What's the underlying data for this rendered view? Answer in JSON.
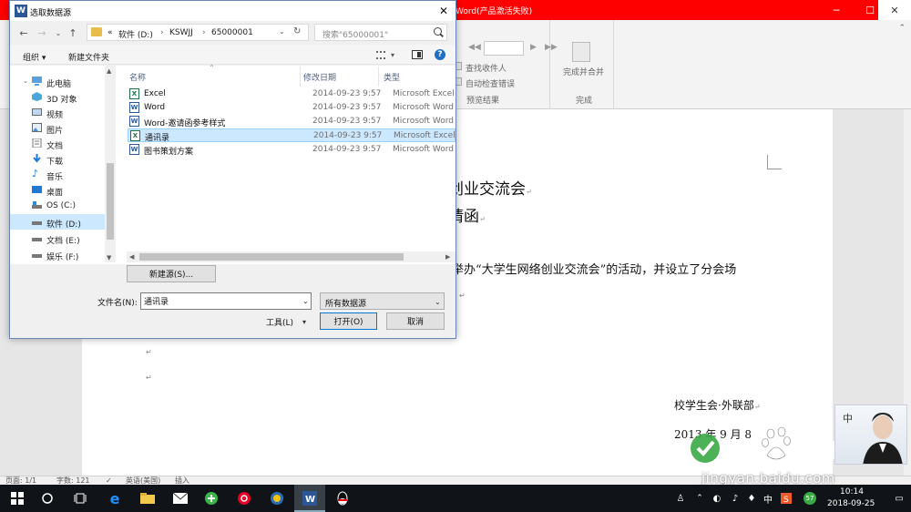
{
  "word": {
    "title_suffix": "Word(产品激活失败)",
    "ribbon": {
      "find_recipient": "查找收件人",
      "auto_check": "自动检查错误",
      "preview_group": "预览结果",
      "finish_merge": "完成并合并",
      "finish_group": "完成"
    },
    "document": {
      "title_line1": "创业交流会",
      "title_line2": "请函",
      "body_line": "举办“大学生网络创业交流会”的活动，并设立了分会场",
      "sign_line1": "校学生会·外联部",
      "sign_line2": "2013 年 9 月 8",
      "para_mark": "↵"
    },
    "status": {
      "page": "页面: 1/1",
      "words": "字数: 121",
      "language": "英语(美国)",
      "insert": "插入"
    }
  },
  "watermark": {
    "url": "jingyan.baidu.com"
  },
  "taskbar": {
    "time": "10:14",
    "date": "2018-09-25",
    "ime": "中",
    "badge": "57"
  },
  "dialog": {
    "title": "选取数据源",
    "title_icon": "W",
    "address": {
      "prefix": "«",
      "segments": [
        "软件 (D:)",
        "KSWJJ",
        "65000001"
      ],
      "separator": "›"
    },
    "search_placeholder": "搜索\"65000001\"",
    "commands": {
      "organize": "组织 ▾",
      "new_folder": "新建文件夹"
    },
    "nav_items": [
      {
        "label": "此电脑",
        "icon": "computer-icon"
      },
      {
        "label": "3D 对象",
        "icon": "cube-icon"
      },
      {
        "label": "视频",
        "icon": "video-icon"
      },
      {
        "label": "图片",
        "icon": "picture-icon"
      },
      {
        "label": "文档",
        "icon": "document-icon"
      },
      {
        "label": "下载",
        "icon": "download-icon"
      },
      {
        "label": "音乐",
        "icon": "music-icon"
      },
      {
        "label": "桌面",
        "icon": "desktop-icon"
      },
      {
        "label": "OS (C:)",
        "icon": "drive-icon"
      },
      {
        "label": "软件 (D:)",
        "icon": "drive-icon"
      },
      {
        "label": "文档 (E:)",
        "icon": "drive-icon"
      },
      {
        "label": "娱乐 (F:)",
        "icon": "drive-icon"
      }
    ],
    "selected_nav_index": 9,
    "columns": {
      "name": "名称",
      "date": "修改日期",
      "type": "类型"
    },
    "files": [
      {
        "name": "Excel",
        "date": "2014-09-23 9:57",
        "type": "Microsoft Excel",
        "kind": "excel"
      },
      {
        "name": "Word",
        "date": "2014-09-23 9:57",
        "type": "Microsoft Word",
        "kind": "word"
      },
      {
        "name": "Word-邀请函参考样式",
        "date": "2014-09-23 9:57",
        "type": "Microsoft Word",
        "kind": "word"
      },
      {
        "name": "通讯录",
        "date": "2014-09-23 9:57",
        "type": "Microsoft Excel",
        "kind": "excel"
      },
      {
        "name": "图书策划方案",
        "date": "2014-09-23 9:57",
        "type": "Microsoft Word",
        "kind": "word"
      }
    ],
    "selected_file_index": 3,
    "new_source_button": "新建源(S)...",
    "filename_label": "文件名(N):",
    "filename_value": "通讯录",
    "filetype_value": "所有数据源",
    "tools_label": "工具(L)",
    "open_button": "打开(O)",
    "cancel_button": "取消"
  },
  "colors": {
    "word_titlebar": "#ff0000",
    "selection": "#cce8ff",
    "excel_icon": "#1e7145",
    "word_icon": "#2b5797",
    "taskbar": "#101418"
  }
}
